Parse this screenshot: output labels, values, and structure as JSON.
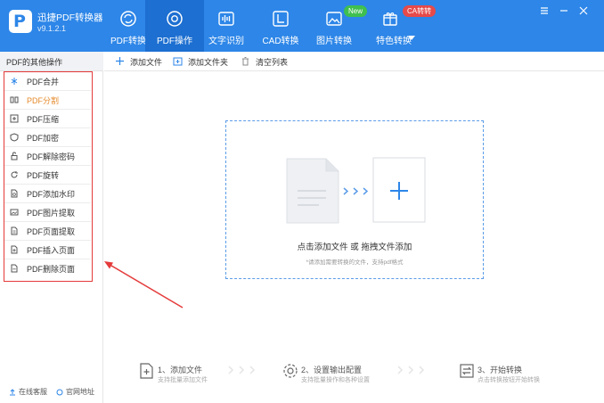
{
  "app": {
    "name": "迅捷PDF转换器",
    "version": "v9.1.2.1",
    "logo_letter": "P"
  },
  "nav": [
    {
      "label": "PDF转换",
      "icon": "refresh-icon"
    },
    {
      "label": "PDF操作",
      "icon": "settings-circle-icon",
      "active": true
    },
    {
      "label": "文字识别",
      "icon": "waveform-icon"
    },
    {
      "label": "CAD转换",
      "icon": "cad-icon"
    },
    {
      "label": "图片转换",
      "icon": "image-icon"
    },
    {
      "label": "特色转换",
      "icon": "gift-box-icon"
    }
  ],
  "badges": {
    "new": "New",
    "ca": "CA转转"
  },
  "sidebar": {
    "title": "PDF的其他操作",
    "items": [
      {
        "label": "PDF合并",
        "icon": "merge-icon"
      },
      {
        "label": "PDF分割",
        "icon": "split-icon",
        "active": true
      },
      {
        "label": "PDF压缩",
        "icon": "compress-icon"
      },
      {
        "label": "PDF加密",
        "icon": "shield-icon"
      },
      {
        "label": "PDF解除密码",
        "icon": "unlock-icon"
      },
      {
        "label": "PDF旋转",
        "icon": "rotate-icon"
      },
      {
        "label": "PDF添加水印",
        "icon": "watermark-icon"
      },
      {
        "label": "PDF图片提取",
        "icon": "image-extract-icon"
      },
      {
        "label": "PDF页面提取",
        "icon": "page-extract-icon"
      },
      {
        "label": "PDF插入页面",
        "icon": "page-insert-icon"
      },
      {
        "label": "PDF删除页面",
        "icon": "page-delete-icon"
      }
    ],
    "footer": {
      "support": "在线客服",
      "website": "官网地址"
    }
  },
  "toolbar": {
    "add_file": "添加文件",
    "add_folder": "添加文件夹",
    "clear_list": "清空列表"
  },
  "dropzone": {
    "main": "点击添加文件 或 拖拽文件添加",
    "hint": "*请添加需要转换的文件，支持pdf格式"
  },
  "steps": [
    {
      "title": "1、添加文件",
      "desc": "支持批量添加文件"
    },
    {
      "title": "2、设置输出配置",
      "desc": "支持批量操作和各种设置"
    },
    {
      "title": "3、开始转换",
      "desc": "点击转换按钮开始转换"
    }
  ],
  "colors": {
    "header": "#2d86e8",
    "header_active": "#1d6fd1",
    "highlight_border": "#e53b3b",
    "active_text": "#e58a2b",
    "dropzone_border": "#5b9ce8"
  }
}
